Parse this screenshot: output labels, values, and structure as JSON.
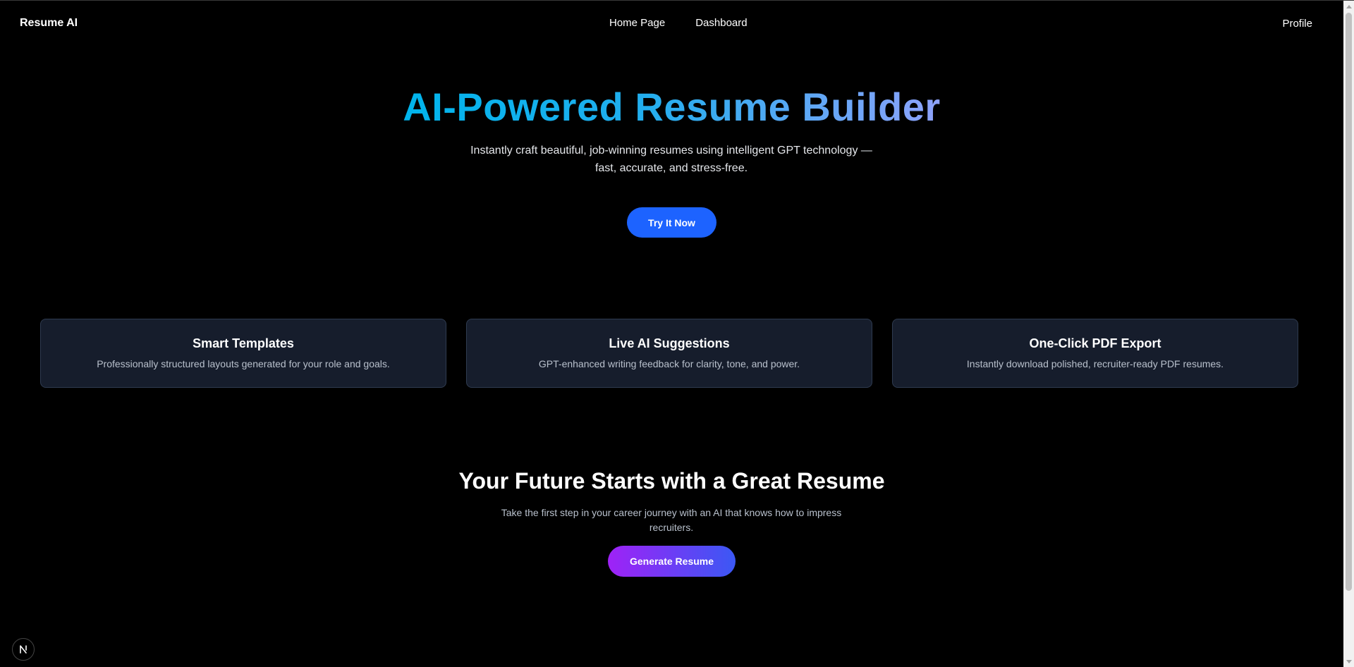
{
  "navbar": {
    "brand": "Resume AI",
    "links": [
      "Home Page",
      "Dashboard"
    ],
    "profile": "Profile"
  },
  "hero": {
    "title": "AI-Powered Resume Builder",
    "subtitle": "Instantly craft beautiful, job-winning resumes using intelligent GPT technology — fast, accurate, and stress-free.",
    "button": "Try It Now"
  },
  "features": [
    {
      "title": "Smart Templates",
      "description": "Professionally structured layouts generated for your role and goals."
    },
    {
      "title": "Live AI Suggestions",
      "description": "GPT-enhanced writing feedback for clarity, tone, and power."
    },
    {
      "title": "One-Click PDF Export",
      "description": "Instantly download polished, recruiter-ready PDF resumes."
    }
  ],
  "cta": {
    "title": "Your Future Starts with a Great Resume",
    "subtitle": "Take the first step in your career journey with an AI that knows how to impress recruiters.",
    "button": "Generate Resume"
  },
  "dev_indicator": {
    "icon": "nextjs-logo-icon",
    "letter": "N"
  },
  "colors": {
    "background": "#000000",
    "primary_button": "#1d63ff",
    "gradient_start": "#9f22f6",
    "gradient_end": "#3b58f4",
    "title_gradient_start": "#00b4ec",
    "title_gradient_end": "#8ea2fb",
    "card_background": "#161d2c"
  }
}
